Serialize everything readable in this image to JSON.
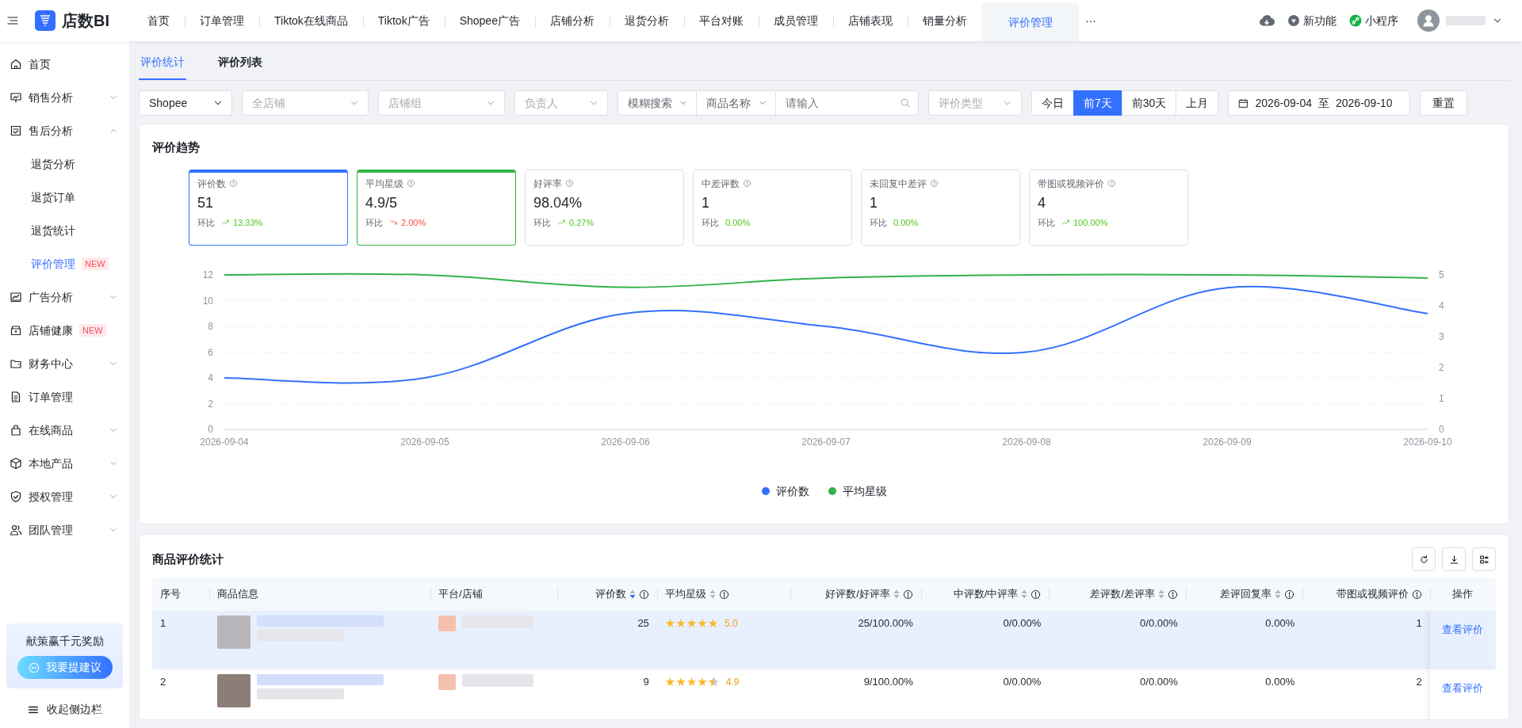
{
  "header": {
    "logo_text": "店数BI",
    "nav": [
      {
        "label": "首页",
        "selected": false
      },
      {
        "label": "订单管理",
        "selected": false
      },
      {
        "label": "Tiktok在线商品",
        "selected": false
      },
      {
        "label": "Tiktok广告",
        "selected": false
      },
      {
        "label": "Shopee广告",
        "selected": false
      },
      {
        "label": "店铺分析",
        "selected": false
      },
      {
        "label": "退货分析",
        "selected": false
      },
      {
        "label": "平台对账",
        "selected": false
      },
      {
        "label": "成员管理",
        "selected": false
      },
      {
        "label": "店铺表现",
        "selected": false
      },
      {
        "label": "销量分析",
        "selected": false
      },
      {
        "label": "评价管理",
        "selected": true
      }
    ],
    "more": "···",
    "new_features": "新功能",
    "mini_program": "小程序"
  },
  "sidebar": {
    "items": [
      {
        "label": "首页",
        "selected": false
      },
      {
        "label": "销售分析",
        "selected": false,
        "expanded": false
      },
      {
        "label": "售后分析",
        "selected": false,
        "expanded": true,
        "children": [
          {
            "label": "退货分析",
            "selected": false
          },
          {
            "label": "退货订单",
            "selected": false
          },
          {
            "label": "退货统计",
            "selected": false
          },
          {
            "label": "评价管理",
            "selected": true,
            "badge": "NEW"
          }
        ]
      },
      {
        "label": "广告分析",
        "selected": false,
        "expanded": false
      },
      {
        "label": "店铺健康",
        "selected": false,
        "badge": "NEW"
      },
      {
        "label": "财务中心",
        "selected": false,
        "expanded": false
      },
      {
        "label": "订单管理",
        "selected": false
      },
      {
        "label": "在线商品",
        "selected": false,
        "expanded": false
      },
      {
        "label": "本地产品",
        "selected": false,
        "expanded": false
      },
      {
        "label": "授权管理",
        "selected": false,
        "expanded": false
      },
      {
        "label": "团队管理",
        "selected": false,
        "expanded": false
      }
    ],
    "promo": {
      "text": "献策赢千元奖励",
      "button": "我要提建议"
    },
    "collapse": "收起侧边栏"
  },
  "tabs": [
    {
      "label": "评价统计",
      "selected": true
    },
    {
      "label": "评价列表",
      "selected": false
    }
  ],
  "filters": {
    "selects": [
      {
        "value": "Shopee"
      },
      {
        "placeholder": "全店铺"
      },
      {
        "placeholder": "店铺组"
      },
      {
        "placeholder": "负责人"
      }
    ],
    "search_mode": "模糊搜索",
    "search_field": "商品名称",
    "search_placeholder": "请输入",
    "review_type": {
      "placeholder": "评价类型"
    },
    "ranges": [
      {
        "label": "今日",
        "selected": false
      },
      {
        "label": "前7天",
        "selected": true
      },
      {
        "label": "前30天",
        "selected": false
      },
      {
        "label": "上月",
        "selected": false
      }
    ],
    "date_from": "2026-09-04",
    "date_sep": "至",
    "date_to": "2026-09-10",
    "reset": "重置"
  },
  "trend": {
    "title": "评价趋势",
    "stats": [
      {
        "label": "评价数",
        "value": "51",
        "compare": "环比",
        "change": "13.33%",
        "up": true,
        "down": false,
        "selected": true,
        "color": "#3370ff"
      },
      {
        "label": "平均星级",
        "value": "4.9/5",
        "compare": "环比",
        "change": "2.00%",
        "up": false,
        "down": true,
        "selected": true,
        "color": "#34b349"
      },
      {
        "label": "好评率",
        "value": "98.04%",
        "compare": "环比",
        "change": "0.27%",
        "up": true,
        "down": false,
        "selected": false
      },
      {
        "label": "中差评数",
        "value": "1",
        "compare": "环比",
        "change": "0.00%",
        "up": false,
        "down": false,
        "selected": false
      },
      {
        "label": "未回复中差评",
        "value": "1",
        "compare": "环比",
        "change": "0.00%",
        "up": false,
        "down": false,
        "selected": false
      },
      {
        "label": "带图或视频评价",
        "value": "4",
        "compare": "环比",
        "change": "100.00%",
        "up": true,
        "down": false,
        "selected": false
      }
    ],
    "chart_data": {
      "type": "line",
      "categories": [
        "2026-09-04",
        "2026-09-05",
        "2026-09-06",
        "2026-09-07",
        "2026-09-08",
        "2026-09-09",
        "2026-09-10"
      ],
      "series": [
        {
          "name": "评价数",
          "color": "#3370ff",
          "values": [
            4,
            4,
            9,
            8,
            6,
            11,
            9
          ]
        },
        {
          "name": "平均星级",
          "color": "#34b349",
          "axis": "y2",
          "values": [
            5,
            5,
            4.6,
            4.9,
            5,
            5,
            4.9
          ]
        }
      ],
      "grid": true,
      "ylim": [
        0,
        12
      ],
      "yticks": [
        0,
        2,
        4,
        6,
        8,
        10,
        12
      ],
      "y2lim": [
        0,
        5
      ],
      "y2ticks": [
        0,
        1,
        2,
        3,
        4,
        5
      ]
    }
  },
  "product_table": {
    "title": "商品评价统计",
    "columns": [
      {
        "label": "序号"
      },
      {
        "label": "商品信息"
      },
      {
        "label": "平台/店铺"
      },
      {
        "label": "评价数",
        "sortable": true,
        "sorted_desc": true,
        "info": true
      },
      {
        "label": "平均星级",
        "sortable": true,
        "sorted_desc": false,
        "info": true
      },
      {
        "label": "好评数/好评率",
        "sortable": true,
        "sorted_desc": false,
        "info": true
      },
      {
        "label": "中评数/中评率",
        "sortable": true,
        "sorted_desc": false,
        "info": true
      },
      {
        "label": "差评数/差评率",
        "sortable": true,
        "sorted_desc": false,
        "info": true
      },
      {
        "label": "差评回复率",
        "sortable": true,
        "sorted_desc": false,
        "info": true
      },
      {
        "label": "带图或视频评价",
        "info": true
      },
      {
        "label": "操作"
      }
    ],
    "rows": [
      {
        "index": "1",
        "selected": true,
        "reviews": "25",
        "stars": 5,
        "rating": "5.0",
        "good": "25/100.00%",
        "mid": "0/0.00%",
        "bad": "0/0.00%",
        "reply_rate": "0.00%",
        "media": "1",
        "action": "查看评价"
      },
      {
        "index": "2",
        "selected": false,
        "reviews": "9",
        "stars": 4.5,
        "rating": "4.9",
        "good": "9/100.00%",
        "mid": "0/0.00%",
        "bad": "0/0.00%",
        "reply_rate": "0.00%",
        "media": "2",
        "action": "查看评价"
      }
    ]
  }
}
